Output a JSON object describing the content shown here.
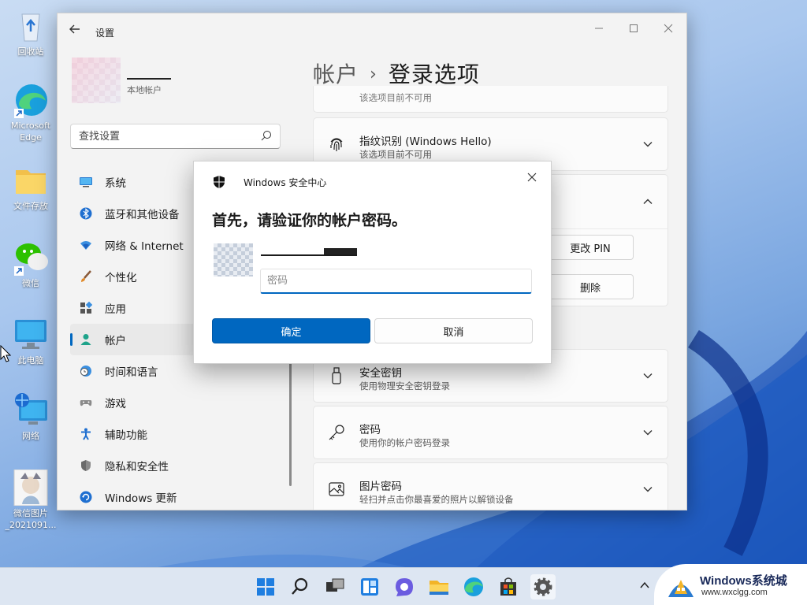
{
  "desktop": {
    "icons": [
      {
        "label": "回收站",
        "icon": "recycle-bin-icon"
      },
      {
        "label": "Microsoft Edge",
        "icon": "edge-icon"
      },
      {
        "label": "文件存放",
        "icon": "folder-icon"
      },
      {
        "label": "微信",
        "icon": "wechat-icon"
      },
      {
        "label": "此电脑",
        "icon": "monitor-icon"
      },
      {
        "label": "网络",
        "icon": "network-icon"
      },
      {
        "label": "微信图片_2021091...",
        "icon": "image-file-icon"
      }
    ]
  },
  "settings": {
    "window_title": "设置",
    "profile": {
      "sub_label": "本地帐户"
    },
    "search": {
      "placeholder": "查找设置"
    },
    "nav": [
      {
        "label": "系统",
        "icon": "system-icon"
      },
      {
        "label": "蓝牙和其他设备",
        "icon": "bluetooth-icon"
      },
      {
        "label": "网络 & Internet",
        "icon": "wifi-icon"
      },
      {
        "label": "个性化",
        "icon": "brush-icon"
      },
      {
        "label": "应用",
        "icon": "apps-icon"
      },
      {
        "label": "帐户",
        "icon": "account-icon",
        "active": true
      },
      {
        "label": "时间和语言",
        "icon": "clock-globe-icon"
      },
      {
        "label": "游戏",
        "icon": "gamepad-icon"
      },
      {
        "label": "辅助功能",
        "icon": "accessibility-icon"
      },
      {
        "label": "隐私和安全性",
        "icon": "shield-icon"
      },
      {
        "label": "Windows 更新",
        "icon": "update-icon"
      }
    ],
    "breadcrumb": {
      "parent": "帐户",
      "separator": "›",
      "current": "登录选项"
    },
    "cards": {
      "partial_sub": "该选项目前不可用",
      "fingerprint": {
        "title": "指纹识别 (Windows Hello)",
        "sub": "该选项目前不可用"
      },
      "pin": {
        "change_label": "更改 PIN",
        "delete_label": "删除"
      },
      "security_key": {
        "title": "安全密钥",
        "sub": "使用物理安全密钥登录"
      },
      "password": {
        "title": "密码",
        "sub": "使用你的帐户密码登录"
      },
      "picture_password": {
        "title": "图片密码",
        "sub": "轻扫并点击你最喜爱的照片以解锁设备"
      }
    }
  },
  "dialog": {
    "title": "Windows 安全中心",
    "heading": "首先，请验证你的帐户密码。",
    "password_placeholder": "密码",
    "ok_label": "确定",
    "cancel_label": "取消"
  },
  "watermark": {
    "title": "Windows系统城",
    "url": "www.wxclgg.com"
  },
  "colors": {
    "accent": "#0067c0",
    "window_bg": "#f3f3f3",
    "card_bg": "#fbfbfb"
  }
}
